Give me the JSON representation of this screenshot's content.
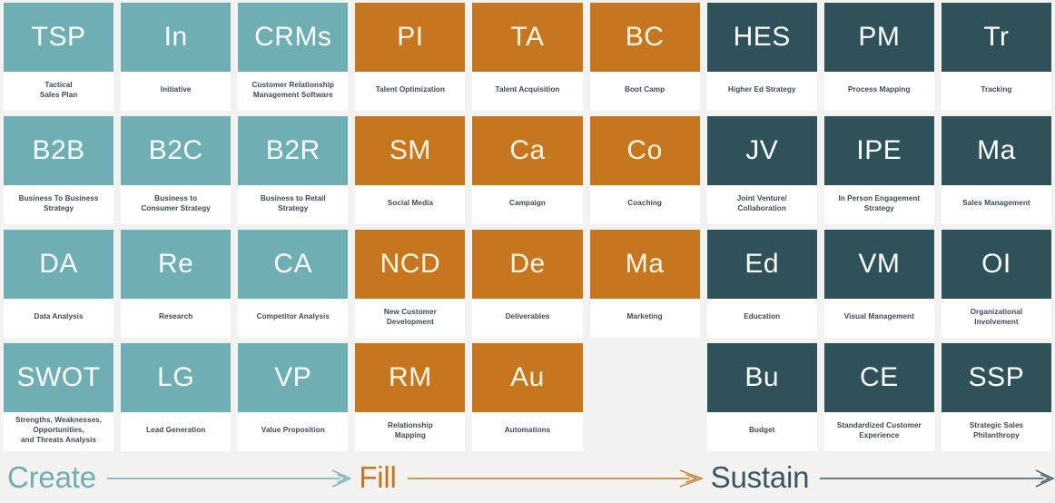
{
  "palette": {
    "teal": "#6fafb4",
    "orange": "#c5761f",
    "slate": "#2f515a",
    "background": "#f2f2f0",
    "card_bg": "#ffffff",
    "label_text": "#3b4a57"
  },
  "grid": {
    "columns": 9,
    "rows": 4,
    "cards": [
      {
        "abbr": "TSP",
        "label": "Tactical\nSales Plan",
        "color": "teal",
        "row": 1,
        "col": 1
      },
      {
        "abbr": "In",
        "label": "Initiative",
        "color": "teal",
        "row": 1,
        "col": 2
      },
      {
        "abbr": "CRMs",
        "label": "Customer Relationship\nManagement Software",
        "color": "teal",
        "row": 1,
        "col": 3
      },
      {
        "abbr": "PI",
        "label": "Talent Optimization",
        "color": "orange",
        "row": 1,
        "col": 4
      },
      {
        "abbr": "TA",
        "label": "Talent Acquisition",
        "color": "orange",
        "row": 1,
        "col": 5
      },
      {
        "abbr": "BC",
        "label": "Boot Camp",
        "color": "orange",
        "row": 1,
        "col": 6
      },
      {
        "abbr": "HES",
        "label": "Higher Ed Strategy",
        "color": "slate",
        "row": 1,
        "col": 7
      },
      {
        "abbr": "PM",
        "label": "Process Mapping",
        "color": "slate",
        "row": 1,
        "col": 8
      },
      {
        "abbr": "Tr",
        "label": "Tracking",
        "color": "slate",
        "row": 1,
        "col": 9
      },
      {
        "abbr": "B2B",
        "label": "Business To Business\nStrategy",
        "color": "teal",
        "row": 2,
        "col": 1
      },
      {
        "abbr": "B2C",
        "label": "Business to\nConsumer Strategy",
        "color": "teal",
        "row": 2,
        "col": 2
      },
      {
        "abbr": "B2R",
        "label": "Business to Retail\nStrategy",
        "color": "teal",
        "row": 2,
        "col": 3
      },
      {
        "abbr": "SM",
        "label": "Social Media",
        "color": "orange",
        "row": 2,
        "col": 4
      },
      {
        "abbr": "Ca",
        "label": "Campaign",
        "color": "orange",
        "row": 2,
        "col": 5
      },
      {
        "abbr": "Co",
        "label": "Coaching",
        "color": "orange",
        "row": 2,
        "col": 6
      },
      {
        "abbr": "JV",
        "label": "Joint Venture/\nCollaboration",
        "color": "slate",
        "row": 2,
        "col": 7
      },
      {
        "abbr": "IPE",
        "label": "In Person Engagement\nStrategy",
        "color": "slate",
        "row": 2,
        "col": 8
      },
      {
        "abbr": "Ma",
        "label": "Sales Management",
        "color": "slate",
        "row": 2,
        "col": 9
      },
      {
        "abbr": "DA",
        "label": "Data Analysis",
        "color": "teal",
        "row": 3,
        "col": 1
      },
      {
        "abbr": "Re",
        "label": "Research",
        "color": "teal",
        "row": 3,
        "col": 2
      },
      {
        "abbr": "CA",
        "label": "Competitor Analysis",
        "color": "teal",
        "row": 3,
        "col": 3
      },
      {
        "abbr": "NCD",
        "label": "New Customer\nDevelopment",
        "color": "orange",
        "row": 3,
        "col": 4
      },
      {
        "abbr": "De",
        "label": "Deliverables",
        "color": "orange",
        "row": 3,
        "col": 5
      },
      {
        "abbr": "Ma",
        "label": "Marketing",
        "color": "orange",
        "row": 3,
        "col": 6
      },
      {
        "abbr": "Ed",
        "label": "Education",
        "color": "slate",
        "row": 3,
        "col": 7
      },
      {
        "abbr": "VM",
        "label": "Visual Management",
        "color": "slate",
        "row": 3,
        "col": 8
      },
      {
        "abbr": "OI",
        "label": "Organizational\nInvolvement",
        "color": "slate",
        "row": 3,
        "col": 9
      },
      {
        "abbr": "SWOT",
        "label": "Strengths, Weaknesses,\nOpportunities,\nand Threats Analysis",
        "color": "teal",
        "row": 4,
        "col": 1
      },
      {
        "abbr": "LG",
        "label": "Lead Generation",
        "color": "teal",
        "row": 4,
        "col": 2
      },
      {
        "abbr": "VP",
        "label": "Value Proposition",
        "color": "teal",
        "row": 4,
        "col": 3
      },
      {
        "abbr": "RM",
        "label": "Relationship\nMapping",
        "color": "orange",
        "row": 4,
        "col": 4
      },
      {
        "abbr": "Au",
        "label": "Automations",
        "color": "orange",
        "row": 4,
        "col": 5
      },
      {
        "abbr": "",
        "label": "",
        "color": "empty",
        "row": 4,
        "col": 6
      },
      {
        "abbr": "Bu",
        "label": "Budget",
        "color": "slate",
        "row": 4,
        "col": 7
      },
      {
        "abbr": "CE",
        "label": "Standardized Customer\nExperience",
        "color": "slate",
        "row": 4,
        "col": 8
      },
      {
        "abbr": "SSP",
        "label": "Strategic Sales\nPhilanthropy",
        "color": "slate",
        "row": 4,
        "col": 9
      }
    ]
  },
  "footer": {
    "phases": [
      {
        "name": "Create",
        "color": "#6fafb4",
        "arrow_icon": "arrow-right-icon"
      },
      {
        "name": "Fill",
        "color": "#c5761f",
        "arrow_icon": "arrow-right-icon"
      },
      {
        "name": "Sustain",
        "color": "#3b5560",
        "arrow_icon": "arrow-right-icon"
      }
    ]
  }
}
